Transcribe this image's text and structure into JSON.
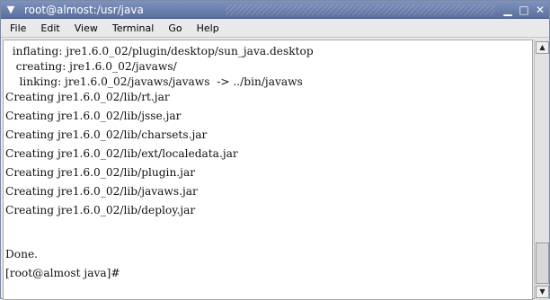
{
  "window": {
    "title": "root@almost:/usr/java",
    "menu_icon": "chevron-down-icon",
    "controls": {
      "minimize": "minimize-icon",
      "maximize": "maximize-icon",
      "close": "close-icon"
    }
  },
  "menubar": {
    "items": [
      "File",
      "Edit",
      "View",
      "Terminal",
      "Go",
      "Help"
    ]
  },
  "terminal": {
    "lines": [
      "  inflating: jre1.6.0_02/plugin/desktop/sun_java.desktop",
      "   creating: jre1.6.0_02/javaws/",
      "    linking: jre1.6.0_02/javaws/javaws  -> ../bin/javaws",
      "Creating jre1.6.0_02/lib/rt.jar",
      "Creating jre1.6.0_02/lib/jsse.jar",
      "Creating jre1.6.0_02/lib/charsets.jar",
      "Creating jre1.6.0_02/lib/ext/localedata.jar",
      "Creating jre1.6.0_02/lib/plugin.jar",
      "Creating jre1.6.0_02/lib/javaws.jar",
      "Creating jre1.6.0_02/lib/deploy.jar",
      "",
      "Done.",
      "[root@almost java]#"
    ]
  },
  "scrollbar": {
    "up_icon": "arrow-up-icon",
    "down_icon": "arrow-down-icon"
  }
}
